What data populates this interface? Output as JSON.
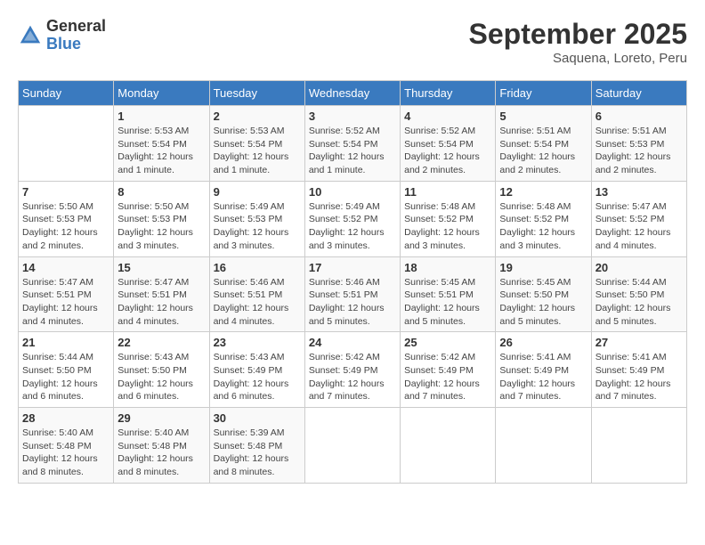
{
  "header": {
    "logo_general": "General",
    "logo_blue": "Blue",
    "month_title": "September 2025",
    "subtitle": "Saquena, Loreto, Peru"
  },
  "days_of_week": [
    "Sunday",
    "Monday",
    "Tuesday",
    "Wednesday",
    "Thursday",
    "Friday",
    "Saturday"
  ],
  "weeks": [
    [
      {
        "day": "",
        "info": ""
      },
      {
        "day": "1",
        "info": "Sunrise: 5:53 AM\nSunset: 5:54 PM\nDaylight: 12 hours\nand 1 minute."
      },
      {
        "day": "2",
        "info": "Sunrise: 5:53 AM\nSunset: 5:54 PM\nDaylight: 12 hours\nand 1 minute."
      },
      {
        "day": "3",
        "info": "Sunrise: 5:52 AM\nSunset: 5:54 PM\nDaylight: 12 hours\nand 1 minute."
      },
      {
        "day": "4",
        "info": "Sunrise: 5:52 AM\nSunset: 5:54 PM\nDaylight: 12 hours\nand 2 minutes."
      },
      {
        "day": "5",
        "info": "Sunrise: 5:51 AM\nSunset: 5:54 PM\nDaylight: 12 hours\nand 2 minutes."
      },
      {
        "day": "6",
        "info": "Sunrise: 5:51 AM\nSunset: 5:53 PM\nDaylight: 12 hours\nand 2 minutes."
      }
    ],
    [
      {
        "day": "7",
        "info": "Sunrise: 5:50 AM\nSunset: 5:53 PM\nDaylight: 12 hours\nand 2 minutes."
      },
      {
        "day": "8",
        "info": "Sunrise: 5:50 AM\nSunset: 5:53 PM\nDaylight: 12 hours\nand 3 minutes."
      },
      {
        "day": "9",
        "info": "Sunrise: 5:49 AM\nSunset: 5:53 PM\nDaylight: 12 hours\nand 3 minutes."
      },
      {
        "day": "10",
        "info": "Sunrise: 5:49 AM\nSunset: 5:52 PM\nDaylight: 12 hours\nand 3 minutes."
      },
      {
        "day": "11",
        "info": "Sunrise: 5:48 AM\nSunset: 5:52 PM\nDaylight: 12 hours\nand 3 minutes."
      },
      {
        "day": "12",
        "info": "Sunrise: 5:48 AM\nSunset: 5:52 PM\nDaylight: 12 hours\nand 3 minutes."
      },
      {
        "day": "13",
        "info": "Sunrise: 5:47 AM\nSunset: 5:52 PM\nDaylight: 12 hours\nand 4 minutes."
      }
    ],
    [
      {
        "day": "14",
        "info": "Sunrise: 5:47 AM\nSunset: 5:51 PM\nDaylight: 12 hours\nand 4 minutes."
      },
      {
        "day": "15",
        "info": "Sunrise: 5:47 AM\nSunset: 5:51 PM\nDaylight: 12 hours\nand 4 minutes."
      },
      {
        "day": "16",
        "info": "Sunrise: 5:46 AM\nSunset: 5:51 PM\nDaylight: 12 hours\nand 4 minutes."
      },
      {
        "day": "17",
        "info": "Sunrise: 5:46 AM\nSunset: 5:51 PM\nDaylight: 12 hours\nand 5 minutes."
      },
      {
        "day": "18",
        "info": "Sunrise: 5:45 AM\nSunset: 5:51 PM\nDaylight: 12 hours\nand 5 minutes."
      },
      {
        "day": "19",
        "info": "Sunrise: 5:45 AM\nSunset: 5:50 PM\nDaylight: 12 hours\nand 5 minutes."
      },
      {
        "day": "20",
        "info": "Sunrise: 5:44 AM\nSunset: 5:50 PM\nDaylight: 12 hours\nand 5 minutes."
      }
    ],
    [
      {
        "day": "21",
        "info": "Sunrise: 5:44 AM\nSunset: 5:50 PM\nDaylight: 12 hours\nand 6 minutes."
      },
      {
        "day": "22",
        "info": "Sunrise: 5:43 AM\nSunset: 5:50 PM\nDaylight: 12 hours\nand 6 minutes."
      },
      {
        "day": "23",
        "info": "Sunrise: 5:43 AM\nSunset: 5:49 PM\nDaylight: 12 hours\nand 6 minutes."
      },
      {
        "day": "24",
        "info": "Sunrise: 5:42 AM\nSunset: 5:49 PM\nDaylight: 12 hours\nand 7 minutes."
      },
      {
        "day": "25",
        "info": "Sunrise: 5:42 AM\nSunset: 5:49 PM\nDaylight: 12 hours\nand 7 minutes."
      },
      {
        "day": "26",
        "info": "Sunrise: 5:41 AM\nSunset: 5:49 PM\nDaylight: 12 hours\nand 7 minutes."
      },
      {
        "day": "27",
        "info": "Sunrise: 5:41 AM\nSunset: 5:49 PM\nDaylight: 12 hours\nand 7 minutes."
      }
    ],
    [
      {
        "day": "28",
        "info": "Sunrise: 5:40 AM\nSunset: 5:48 PM\nDaylight: 12 hours\nand 8 minutes."
      },
      {
        "day": "29",
        "info": "Sunrise: 5:40 AM\nSunset: 5:48 PM\nDaylight: 12 hours\nand 8 minutes."
      },
      {
        "day": "30",
        "info": "Sunrise: 5:39 AM\nSunset: 5:48 PM\nDaylight: 12 hours\nand 8 minutes."
      },
      {
        "day": "",
        "info": ""
      },
      {
        "day": "",
        "info": ""
      },
      {
        "day": "",
        "info": ""
      },
      {
        "day": "",
        "info": ""
      }
    ]
  ]
}
